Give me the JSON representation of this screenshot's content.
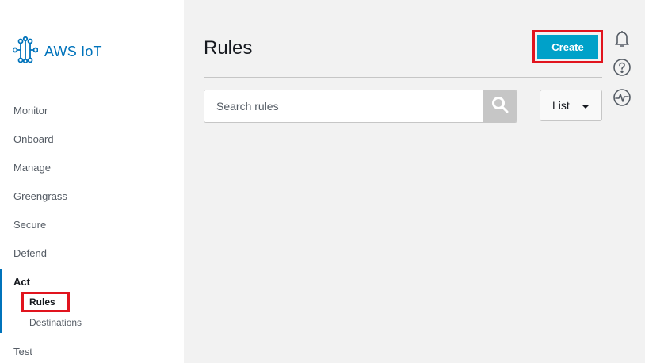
{
  "app": {
    "logo_text": "AWS IoT"
  },
  "sidebar": {
    "items": [
      {
        "label": "Monitor"
      },
      {
        "label": "Onboard"
      },
      {
        "label": "Manage"
      },
      {
        "label": "Greengrass"
      },
      {
        "label": "Secure"
      },
      {
        "label": "Defend"
      },
      {
        "label": "Act"
      },
      {
        "label": "Test"
      }
    ],
    "act_subitems": [
      {
        "label": "Rules"
      },
      {
        "label": "Destinations"
      }
    ]
  },
  "main": {
    "title": "Rules",
    "create_label": "Create",
    "search": {
      "placeholder": "Search rules",
      "value": ""
    },
    "view_select": {
      "selected": "List"
    }
  },
  "icons": {
    "logo": "aws-iot-logo-icon",
    "search": "search-icon",
    "caret": "chevron-down-icon",
    "notifications": "bell-icon",
    "help": "help-icon",
    "activity": "activity-icon"
  },
  "colors": {
    "brand_blue": "#0073bb",
    "create_button": "#00a1c9",
    "highlight_red": "#e1141e",
    "content_bg": "#f2f2f2"
  }
}
